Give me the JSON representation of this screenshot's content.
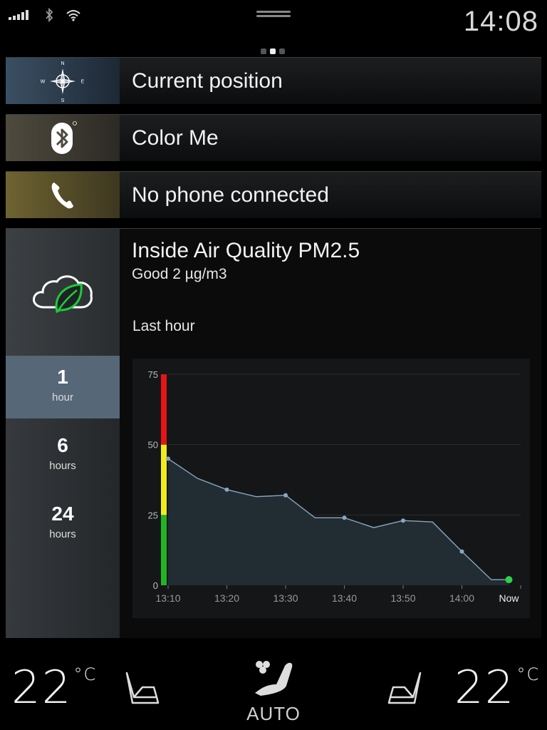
{
  "status_bar": {
    "time": "14:08",
    "signal_bars": 5,
    "page_indicator": {
      "count": 3,
      "active": 1
    }
  },
  "tiles": {
    "navigation": {
      "label": "Current position",
      "icon": "compass-icon",
      "compass": {
        "n": "N",
        "e": "E",
        "s": "S",
        "w": "W"
      }
    },
    "media": {
      "label": "Color Me",
      "icon": "bluetooth-icon"
    },
    "phone": {
      "label": "No phone connected",
      "icon": "phone-icon"
    }
  },
  "air_quality": {
    "icon": "cloud-leaf-icon",
    "title": "Inside Air Quality PM2.5",
    "status": "Good  2 µg/m3",
    "period_label": "Last hour",
    "ranges": [
      {
        "num": "1",
        "unit": "hour",
        "selected": true
      },
      {
        "num": "6",
        "unit": "hours",
        "selected": false
      },
      {
        "num": "24",
        "unit": "hours",
        "selected": false
      }
    ]
  },
  "chart_data": {
    "type": "area",
    "x_labels": [
      "13:10",
      "13:20",
      "13:30",
      "13:40",
      "13:50",
      "14:00",
      "Now"
    ],
    "y_ticks": [
      0,
      25,
      50,
      75
    ],
    "ylim": [
      0,
      75
    ],
    "grid": true,
    "series": [
      {
        "x": [
          0,
          5,
          10,
          15,
          20,
          25,
          30,
          35,
          40,
          45,
          50,
          55,
          58
        ],
        "values": [
          45,
          38,
          34,
          31.5,
          32,
          24,
          24,
          20.5,
          23,
          22.5,
          12,
          2,
          2
        ],
        "markers": [
          0,
          2,
          4,
          6,
          8,
          10,
          12
        ]
      }
    ],
    "threshold_bands": [
      {
        "from": 0,
        "to": 25,
        "color": "#22b424"
      },
      {
        "from": 25,
        "to": 50,
        "color": "#f2ec1c"
      },
      {
        "from": 50,
        "to": 75,
        "color": "#e41515"
      }
    ],
    "line_color": "#8aa6c0",
    "now_color": "#2ed24a"
  },
  "climate": {
    "left_temp": "22",
    "right_temp": "22",
    "unit": "°C",
    "mode": "AUTO"
  }
}
